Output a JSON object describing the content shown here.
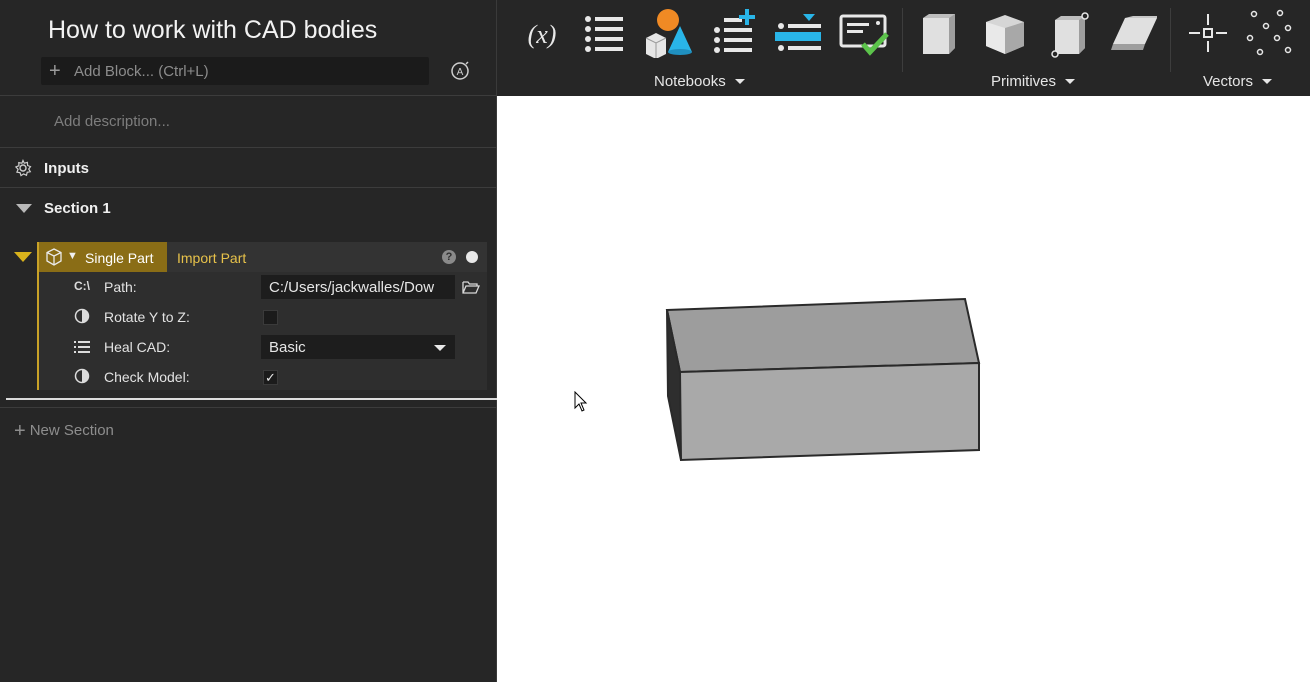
{
  "notebook": {
    "title": "How to work with CAD bodies",
    "add_block_placeholder": "Add Block... (Ctrl+L)",
    "description_placeholder": "Add description..."
  },
  "inputs": {
    "label": "Inputs"
  },
  "section": {
    "label": "Section 1"
  },
  "block": {
    "type_label": "Single Part",
    "name": "Import Part",
    "params": {
      "path": {
        "label": "Path:",
        "icon_text": "C:\\",
        "value": "C:/Users/jackwalles/Dow"
      },
      "rotate": {
        "label": "Rotate Y to Z:",
        "checked": false
      },
      "heal": {
        "label": "Heal CAD:",
        "value": "Basic"
      },
      "check": {
        "label": "Check Model:",
        "checked": true,
        "mark": "✓"
      }
    }
  },
  "new_section_label": "New Section",
  "toolbar": {
    "groups": {
      "notebooks": "Notebooks",
      "primitives": "Primitives",
      "vectors": "Vectors"
    },
    "variable_icon_text": "(x)"
  },
  "colors": {
    "accent_gold": "#c9a227",
    "block_tag_bg": "#8a6d16",
    "panel_bg": "#262626",
    "viewport_bg": "#ffffff",
    "toolbar_orange": "#f08a24",
    "toolbar_cyan": "#29b5e8",
    "toolbar_green": "#5cc34b"
  }
}
